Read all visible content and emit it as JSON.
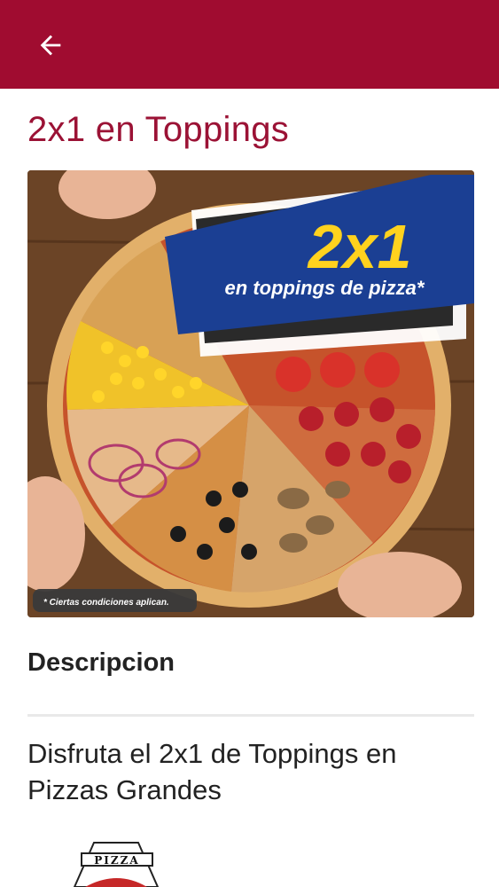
{
  "header": {
    "back_icon": "arrow-left-icon",
    "background": "#a00c30"
  },
  "page": {
    "title": "2x1 en Toppings"
  },
  "promo": {
    "headline": "2x1",
    "subline": "en toppings de pizza*",
    "disclaimer": "* Ciertas condiciones aplican."
  },
  "description": {
    "label": "Descripcion",
    "text": "Disfruta el 2x1 de Toppings en Pizzas Grandes"
  },
  "logo": {
    "text": "PIZZA"
  },
  "colors": {
    "accent": "#9b1235",
    "banner_blue": "#1b3f93",
    "banner_yellow": "#ffd21e"
  }
}
